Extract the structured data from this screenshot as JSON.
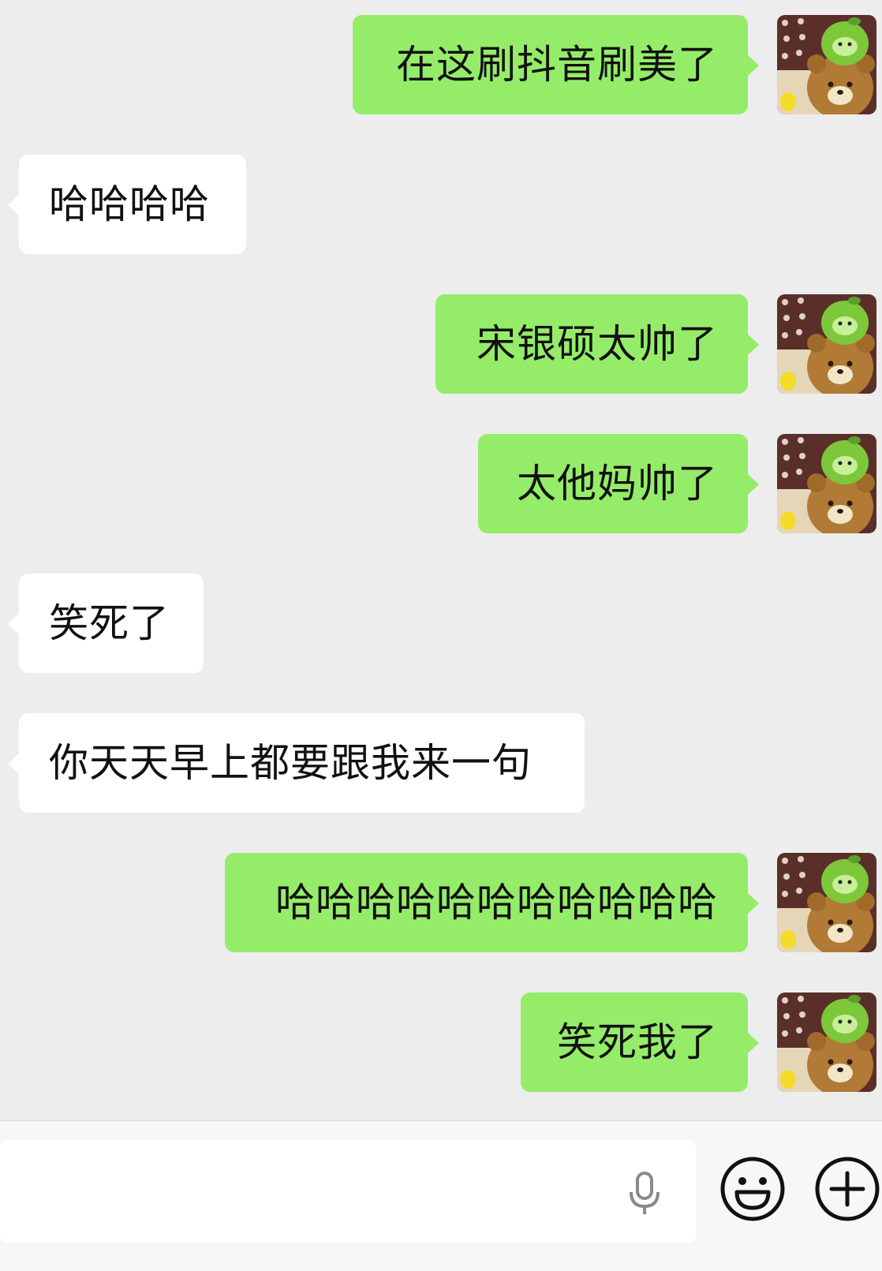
{
  "messages": [
    {
      "sender": "me",
      "text": "在这刷抖音刷美了"
    },
    {
      "sender": "other",
      "text": "哈哈哈哈"
    },
    {
      "sender": "me",
      "text": "宋银硕太帅了"
    },
    {
      "sender": "me",
      "text": "太他妈帅了"
    },
    {
      "sender": "other",
      "text": "笑死了"
    },
    {
      "sender": "other",
      "text": "你天天早上都要跟我来一句"
    },
    {
      "sender": "me",
      "text": "哈哈哈哈哈哈哈哈哈哈哈"
    },
    {
      "sender": "me",
      "text": "笑死我了"
    }
  ],
  "colors": {
    "background": "#ededed",
    "my_bubble": "#95ec69",
    "their_bubble": "#ffffff",
    "text": "#111111",
    "input_bar": "#f7f7f7"
  },
  "input_bar": {
    "icons": [
      "microphone-icon",
      "emoji-icon",
      "plus-icon"
    ]
  }
}
